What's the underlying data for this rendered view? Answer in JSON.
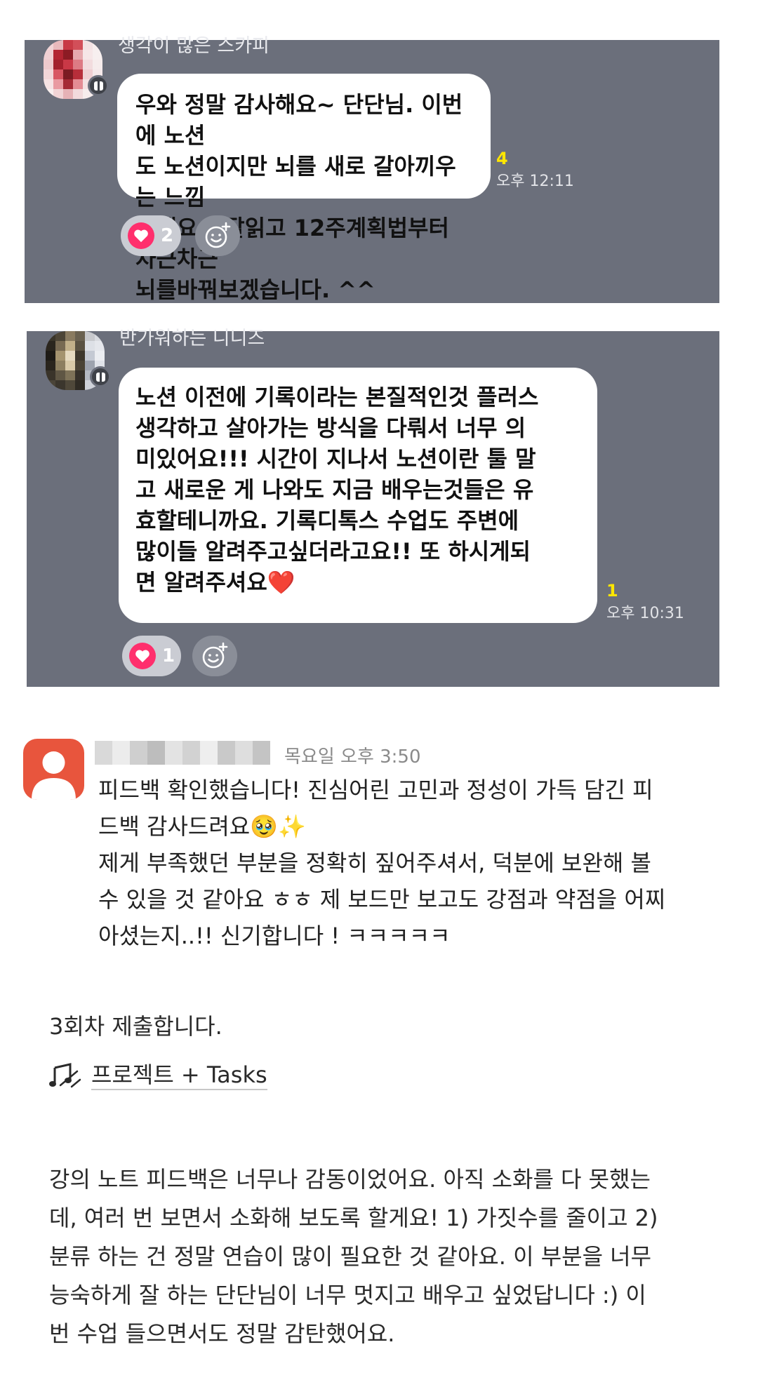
{
  "chat1": {
    "sender": "생각이 많은 스카피",
    "lines": [
      "우와 정말 감사해요~ 단단님. 이번에 노션",
      "도 노션이지만 뇌를 새로 갈아끼우는 느낌",
      "이네요~ 잘읽고 12주계획법부터 차근차근",
      "뇌를바꿔보겠습니다. ^^"
    ],
    "unread": "4",
    "time": "오후 12:11",
    "reaction_count": "2"
  },
  "chat2": {
    "sender": "반가워하는 니니즈",
    "lines": [
      "노션 이전에 기록이라는 본질적인것 플러스",
      "생각하고 살아가는 방식을 다뤄서 너무 의",
      "미있어요!!! 시간이 지나서 노션이란 툴 말",
      "고 새로운 게 나와도 지금 배우는것들은 유",
      "효할테니까요. 기록디톡스 수업도 주변에",
      "많이들 알려주고싶더라고요!! 또 하시게되",
      "면 알려주셔요❤️"
    ],
    "unread": "1",
    "time": "오후 10:31",
    "reaction_count": "1"
  },
  "comment": {
    "time": "목요일 오후 3:50",
    "lines": [
      "피드백 확인했습니다! 진심어린 고민과 정성이 가득 담긴 피",
      "드백 감사드려요🥹✨",
      "제게 부족했던 부분을 정확히 짚어주셔서, 덕분에 보완해 볼",
      "수 있을 것 같아요 ㅎㅎ 제 보드만 보고도 강점과 약점을 어찌",
      "아셨는지..!! 신기합니다 ! ㅋㅋㅋㅋㅋ"
    ]
  },
  "submission": {
    "text": "3회차 제출합니다.",
    "link_icon": "music-notes-icon",
    "link_text": "프로젝트 + Tasks"
  },
  "feedback": {
    "lines": [
      "강의 노트 피드백은 너무나 감동이었어요. 아직 소화를 다 못했는",
      "데, 여러 번 보면서 소화해 보도록 할게요! 1) 가짓수를 줄이고 2)",
      "분류 하는 건 정말 연습이 많이 필요한 것 같아요. 이 부분을 너무",
      "능숙하게 잘 하는 단단님이 너무 멋지고 배우고 싶었답니다 :) 이",
      "번 수업 들으면서도 정말 감탄했어요."
    ]
  },
  "colors": {
    "panel": "#6b6f7b",
    "heart": "#ff2f6d",
    "unread": "#ffe600",
    "avatar_orange": "#e8553d"
  }
}
